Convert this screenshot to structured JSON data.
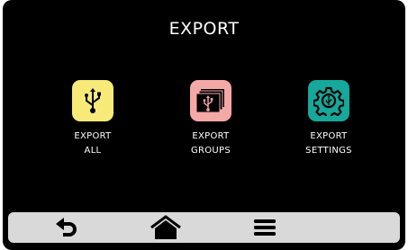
{
  "header": {
    "title": "EXPORT"
  },
  "tiles": [
    {
      "line1": "EXPORT",
      "line2": "ALL",
      "icon": "usb-icon",
      "color": "#f7ea78"
    },
    {
      "line1": "EXPORT",
      "line2": "GROUPS",
      "icon": "usb-stack-icon",
      "color": "#f4a9a7"
    },
    {
      "line1": "EXPORT",
      "line2": "SETTINGS",
      "icon": "gear-icon",
      "color": "#16a89a"
    }
  ],
  "navbar": {
    "items": [
      {
        "icon": "back-icon"
      },
      {
        "icon": "home-icon"
      },
      {
        "icon": "menu-icon"
      }
    ]
  }
}
